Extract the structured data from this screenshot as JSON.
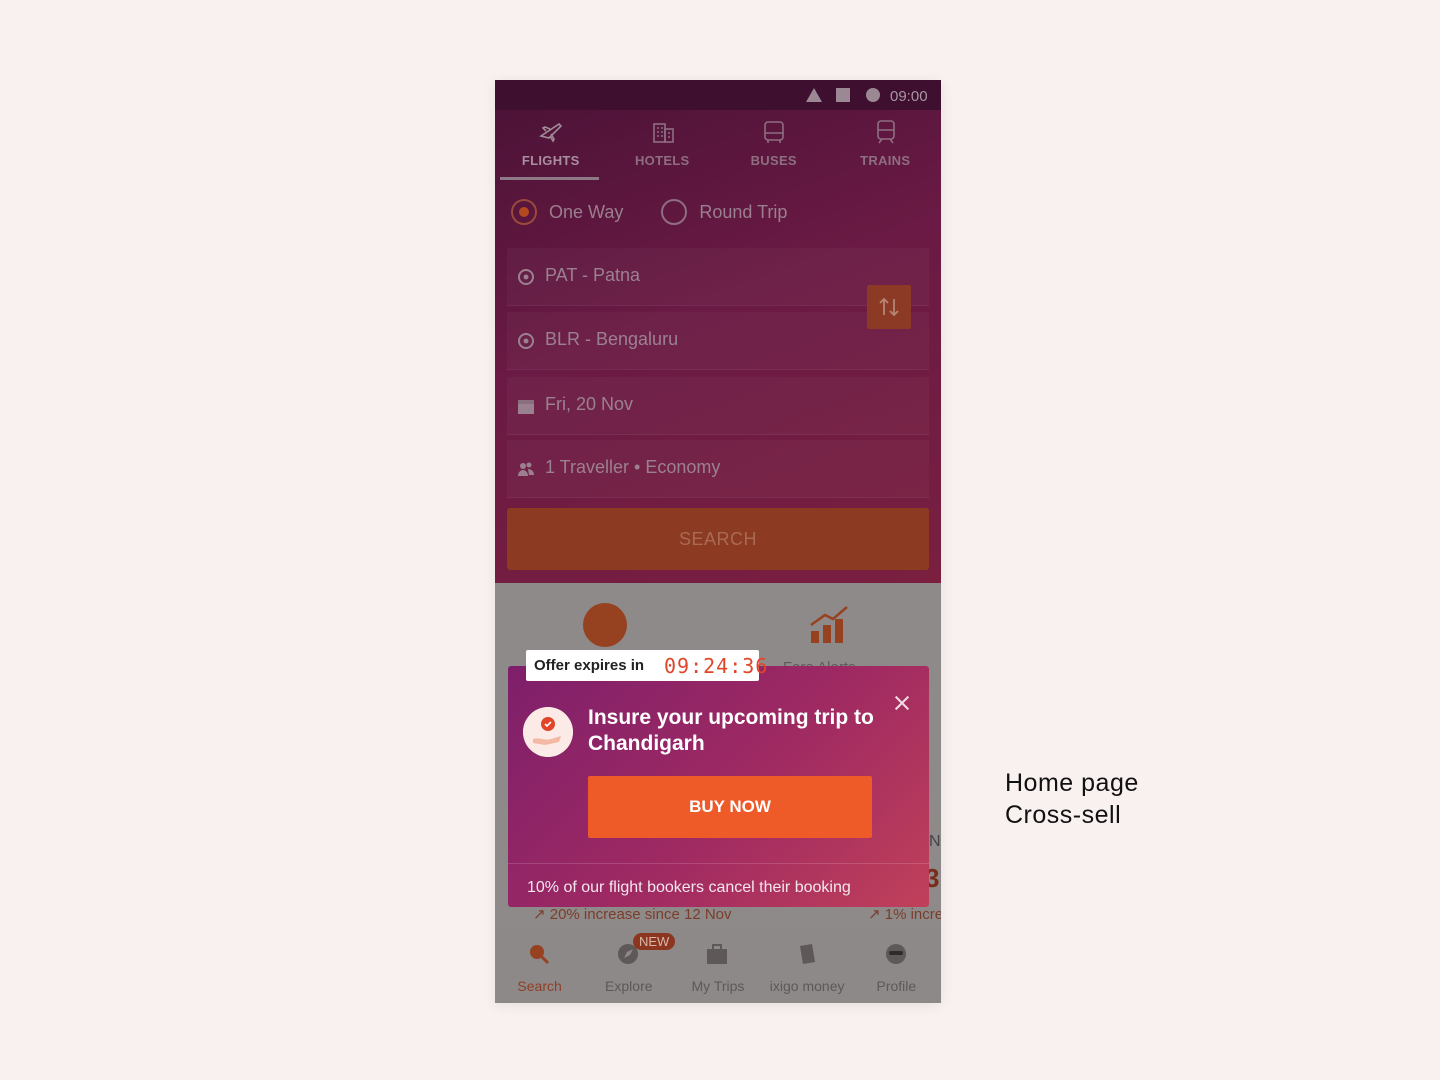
{
  "status_bar": {
    "time": "09:00"
  },
  "tabs": [
    {
      "label": "FLIGHTS",
      "icon": "plane-icon",
      "active": true
    },
    {
      "label": "HOTELS",
      "icon": "building-icon",
      "active": false
    },
    {
      "label": "BUSES",
      "icon": "bus-icon",
      "active": false
    },
    {
      "label": "TRAINS",
      "icon": "train-icon",
      "active": false
    }
  ],
  "trip_type": {
    "one_way": "One Way",
    "round_trip": "Round Trip",
    "selected": "One Way"
  },
  "search_form": {
    "origin": "PAT - Patna",
    "destination": "BLR - Bengaluru",
    "date": "Fri, 20 Nov",
    "travellers": "1 Traveller • Economy",
    "search_label": "SEARCH"
  },
  "background_content": {
    "fare_label": "Fare Alerts",
    "increase_left": "↗ 20% increase since 12 Nov",
    "increase_right": "↗ 1% incre",
    "edge_letter": "N",
    "edge_value": "3"
  },
  "offer": {
    "label": "Offer expires in",
    "countdown": "09:24:36"
  },
  "popup": {
    "title": "Insure your upcoming trip to Chandigarh",
    "button_label": "BUY NOW",
    "footer": "10% of our flight bookers cancel their booking"
  },
  "bottom_nav": [
    {
      "label": "Search",
      "icon": "search-icon",
      "active": true
    },
    {
      "label": "Explore",
      "icon": "compass-icon",
      "active": false
    },
    {
      "label": "My Trips",
      "icon": "suitcase-icon",
      "active": false
    },
    {
      "label": "ixigo money",
      "icon": "wallet-icon",
      "active": false
    },
    {
      "label": "Profile",
      "icon": "profile-icon",
      "active": false
    }
  ],
  "new_badge": "NEW",
  "caption": {
    "line1": "Home page",
    "line2": "Cross-sell"
  },
  "colors": {
    "accent": "#ee5a28",
    "popup_start": "#7e1f6b",
    "popup_end": "#c0405a",
    "countdown": "#e0452a"
  }
}
